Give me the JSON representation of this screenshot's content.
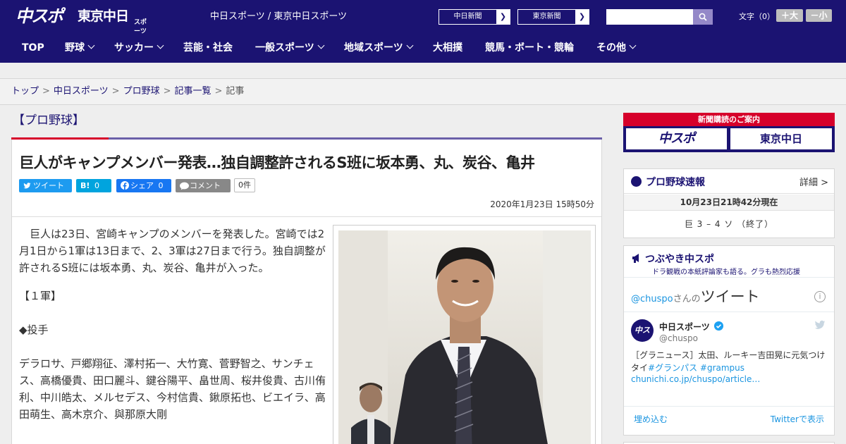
{
  "header": {
    "logo_chuspo": "中スポ",
    "logo_tokyo": "東京中日",
    "logo_tokyo_sub": "スポーツ",
    "site_links": "中日スポーツ / 東京中日スポーツ",
    "newspaper1": "中日新聞",
    "newspaper2": "東京新聞",
    "search_placeholder": "",
    "font_size_label": "文字（0）",
    "font_bigger": "＋大",
    "font_smaller": "－小"
  },
  "nav": {
    "items": [
      "TOP",
      "野球",
      "サッカー",
      "芸能・社会",
      "一般スポーツ",
      "地域スポーツ",
      "大相撲",
      "競馬・ボート・競輪",
      "その他"
    ]
  },
  "breadcrumb": {
    "items": [
      "トップ",
      "中日スポーツ",
      "プロ野球",
      "記事一覧",
      "記事"
    ],
    "separator": ">"
  },
  "article": {
    "category": "【プロ野球】",
    "headline": "巨人がキャンプメンバー発表…独自調整許されるS班に坂本勇、丸、炭谷、亀井",
    "share": {
      "tweet": "ツイート",
      "hatena_icon": "B!",
      "hatena_count": "0",
      "facebook": "シェア",
      "facebook_count": "0",
      "comment": "コメント",
      "comment_count": "0件"
    },
    "date": "2020年1月23日 15時50分",
    "paragraphs": [
      "　巨人は23日、宮崎キャンプのメンバーを発表した。宮崎では2月1日から1軍は13日まで、2、3軍は27日まで行う。独自調整が許されるS班には坂本勇、丸、炭谷、亀井が入った。",
      "【１軍】",
      "",
      "◆投手",
      "",
      "デラロサ、戸郷翔征、澤村拓一、大竹寛、菅野智之、サンチェス、高橋優貴、田口麗斗、鍵谷陽平、畠世周、桜井俊貴、古川侑利、中川皓太、メルセデス、今村信貴、鍬原拓也、ビエイラ、高田萌生、高木京介、與那原大剛"
    ]
  },
  "sidebar": {
    "ad": {
      "top_text": "新聞購読のご案内",
      "logo1": "中スポ",
      "logo2": "東京中日"
    },
    "score": {
      "title": "プロ野球速報",
      "detail": "詳細 >",
      "time": "10月23日21時42分現在",
      "line": "巨 3 – 4 ソ （終了）"
    },
    "twitter": {
      "title": "つぶやき中スポ",
      "subtitle": "ドラ観戦の本紙評論家も語る。グラも熱烈応援",
      "header_handle": "@chuspo",
      "header_suffix": "さんの",
      "header_big": "ツイート",
      "info_icon": "i",
      "avatar": "中スポ",
      "name": "中日スポーツ",
      "handle": "@chuspo",
      "text": "［グラニュース］太田、ルーキー吉田晃に元気つけタイ",
      "tag1": "#グランパス",
      "tag2": "#grampus",
      "url": "chunichi.co.jp/chuspo/article…",
      "embed": "埋め込む",
      "view": "Twitterで表示"
    }
  }
}
